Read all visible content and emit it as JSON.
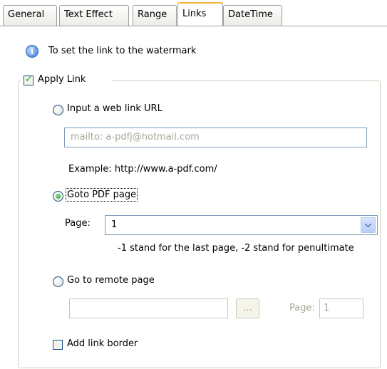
{
  "tabs": [
    {
      "label": "General",
      "active": false
    },
    {
      "label": "Text Effect",
      "active": false
    },
    {
      "label": "Range",
      "active": false
    },
    {
      "label": "Links",
      "active": true
    },
    {
      "label": "DateTime",
      "active": false
    }
  ],
  "info": {
    "text": "To set the link to the watermark"
  },
  "apply_link": {
    "label": "Apply Link",
    "checked": true
  },
  "web_link": {
    "label": "Input a web link URL",
    "value": "mailto: a-pdfj@hotmail.com",
    "example": "Example: http://www.a-pdf.com/"
  },
  "goto_pdf": {
    "label": "Goto PDF page",
    "selected": true,
    "page_label": "Page:",
    "page_value": "1",
    "hint": "-1 stand for the last page, -2 stand for penultimate"
  },
  "remote": {
    "label": "Go to remote page",
    "browse_label": "...",
    "page_label": "Page:",
    "page_value": "1"
  },
  "border": {
    "label": "Add link border",
    "checked": false
  },
  "colors": {
    "accent_tab": "#f7b43b",
    "check": "#21a121",
    "input_border": "#7f9db9"
  }
}
